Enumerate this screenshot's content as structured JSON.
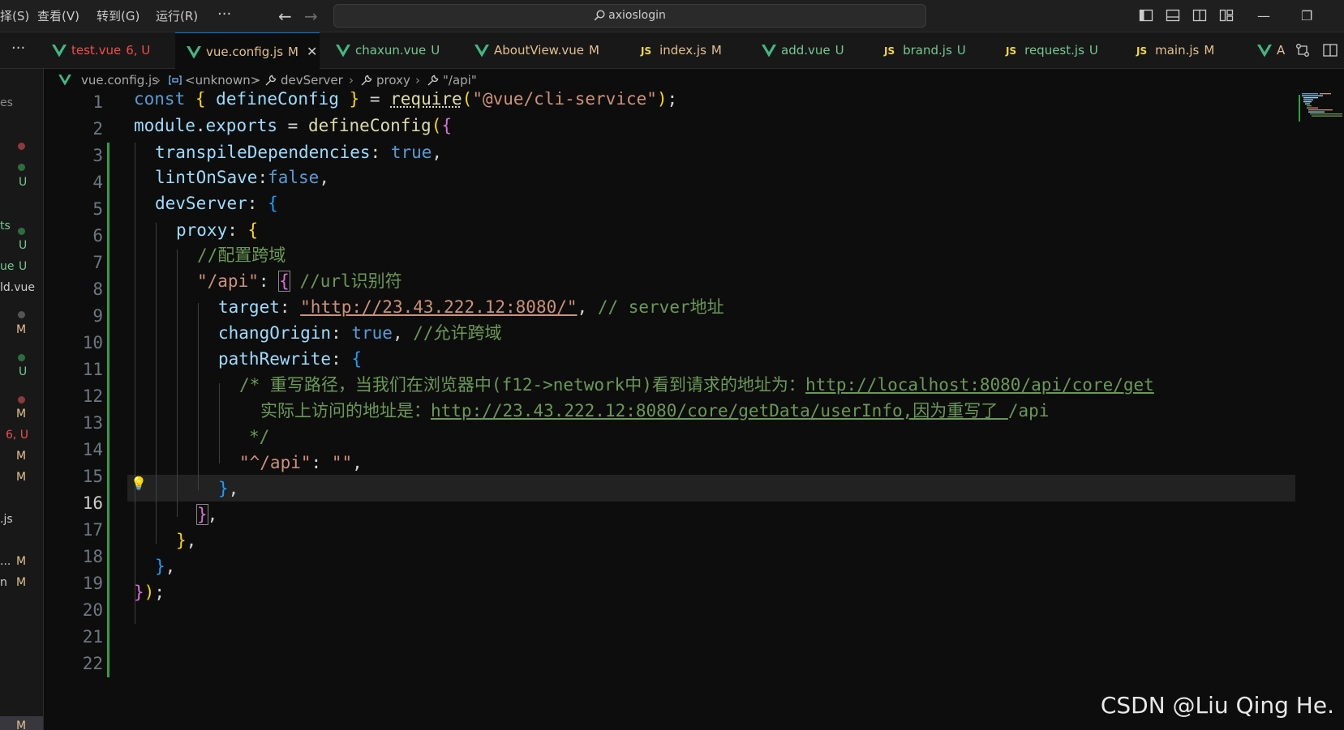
{
  "titlebar": {
    "menus": [
      "择(S)",
      "查看(V)",
      "转到(G)",
      "运行(R)"
    ],
    "more": "···",
    "nav_back": "←",
    "nav_forward": "→",
    "search_text": "axioslogin",
    "win_minimize": "—",
    "win_restore": "❐"
  },
  "tabs": {
    "more": "···",
    "items": [
      {
        "label": "test.vue",
        "status": "6, U",
        "type": "vue"
      },
      {
        "label": "vue.config.js",
        "status": "M",
        "type": "vue",
        "close": "✕"
      },
      {
        "label": "chaxun.vue",
        "status": "U",
        "type": "vue"
      },
      {
        "label": "AboutView.vue",
        "status": "M",
        "type": "vue"
      },
      {
        "label": "index.js",
        "status": "M",
        "type": "js"
      },
      {
        "label": "add.vue",
        "status": "U",
        "type": "vue"
      },
      {
        "label": "brand.js",
        "status": "U",
        "type": "js"
      },
      {
        "label": "request.js",
        "status": "U",
        "type": "js"
      },
      {
        "label": "main.js",
        "status": "M",
        "type": "js"
      },
      {
        "label": "A",
        "status": "",
        "type": "vue"
      }
    ],
    "js_badge": "JS"
  },
  "sidebar": {
    "texts": [
      "es",
      "U",
      "ts",
      "U",
      "ue",
      "U",
      "ld.vue",
      "M",
      "U",
      "M",
      "6, U",
      "M",
      "M",
      ".js",
      "...",
      "M",
      "n",
      "M",
      "M"
    ]
  },
  "breadcrumb": [
    "vue.config.js",
    "<unknown>",
    "devServer",
    "proxy",
    "\"/api\""
  ],
  "editor": {
    "line_numbers": [
      "1",
      "2",
      "3",
      "4",
      "5",
      "6",
      "7",
      "8",
      "9",
      "10",
      "11",
      "12",
      "13",
      "14",
      "15",
      "16",
      "17",
      "18",
      "19",
      "20",
      "21",
      "22"
    ],
    "current_line": "16"
  },
  "code": {
    "l1": [
      "const",
      " ",
      "{",
      " defineConfig ",
      "}",
      " = ",
      "require",
      "(",
      "\"@vue/cli-service\"",
      ")",
      ";"
    ],
    "l2": [
      "module",
      ".",
      "exports",
      " = ",
      "defineConfig",
      "(",
      "{"
    ],
    "l3": [
      "transpileDependencies",
      ": ",
      "true",
      ","
    ],
    "l4": [
      "lintOnSave",
      ":",
      "false",
      ","
    ],
    "l5": [
      "devServer",
      ": ",
      "{"
    ],
    "l6": [
      "proxy",
      ": ",
      "{"
    ],
    "l7": [
      "//配置跨域"
    ],
    "l8": [
      "\"/api\"",
      ": ",
      "{",
      " //url识别符"
    ],
    "l9": [
      "target",
      ": ",
      "\"http://23.43.222.12:8080/\"",
      ", ",
      "// server地址"
    ],
    "l10": [
      "changOrigin",
      ": ",
      "true",
      ", ",
      "//允许跨域"
    ],
    "l11": [
      "pathRewrite",
      ": ",
      "{"
    ],
    "l12": [
      "/* 重写路径，当我们在浏览器中(f12->network中)看到请求的地址为：",
      "http://localhost:8080/api/core/get"
    ],
    "l13": [
      "实际上访问的地址是：",
      "http://23.43.222.12:8080/core/getData/userInfo,因为重写了 ",
      "/api"
    ],
    "l14": [
      "*/"
    ],
    "l15": [
      "\"^/api\"",
      ": ",
      "\"\"",
      ","
    ],
    "l16": [
      "}",
      ","
    ],
    "l17": [
      "}",
      ","
    ],
    "l18": [
      "}",
      ","
    ],
    "l19": [
      "}",
      ","
    ],
    "l20": [
      "}",
      ")",
      ";"
    ],
    "bulb": "💡"
  },
  "watermark": "CSDN @Liu  Qing  He.",
  "colors": {
    "keyword": "#569cd6",
    "function": "#dcdcaa",
    "property": "#9cdcfe",
    "string": "#ce9178",
    "comment": "#6a9955",
    "bracket_gold": "#ffd700",
    "bracket_purple": "#da70d6",
    "bracket_blue": "#179fff",
    "git_added": "#2ea043",
    "untracked": "#73c991",
    "modified": "#e2c08d",
    "error": "#f14c4c"
  }
}
